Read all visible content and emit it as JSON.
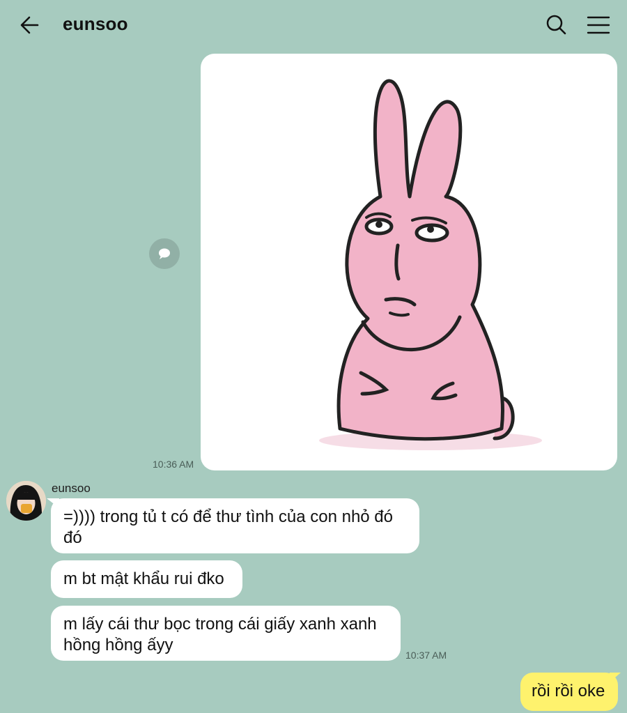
{
  "header": {
    "title": "eunsoo",
    "back_icon": "arrow-left-icon",
    "search_icon": "search-icon",
    "menu_icon": "menu-icon"
  },
  "messages": [
    {
      "type": "sticker",
      "sticker": "pink-rabbit-sticker",
      "time": "10:36 AM"
    },
    {
      "type": "text",
      "sender": "eunsoo",
      "text": "=)))) trong tủ t có để thư tình của con nhỏ đó đó"
    },
    {
      "type": "text",
      "text": "m bt mật khẩu rui đko"
    },
    {
      "type": "text",
      "text": "m lấy cái thư bọc trong cái giấy xanh xanh hồng hồng ấyy",
      "time": "10:37 AM"
    },
    {
      "type": "text",
      "outgoing": true,
      "text": "rồi rồi oke"
    }
  ],
  "colors": {
    "background": "#a7cbbf",
    "incoming_bubble": "#ffffff",
    "outgoing_bubble": "#fef26d",
    "sticker_fill": "#f2b3c8"
  }
}
